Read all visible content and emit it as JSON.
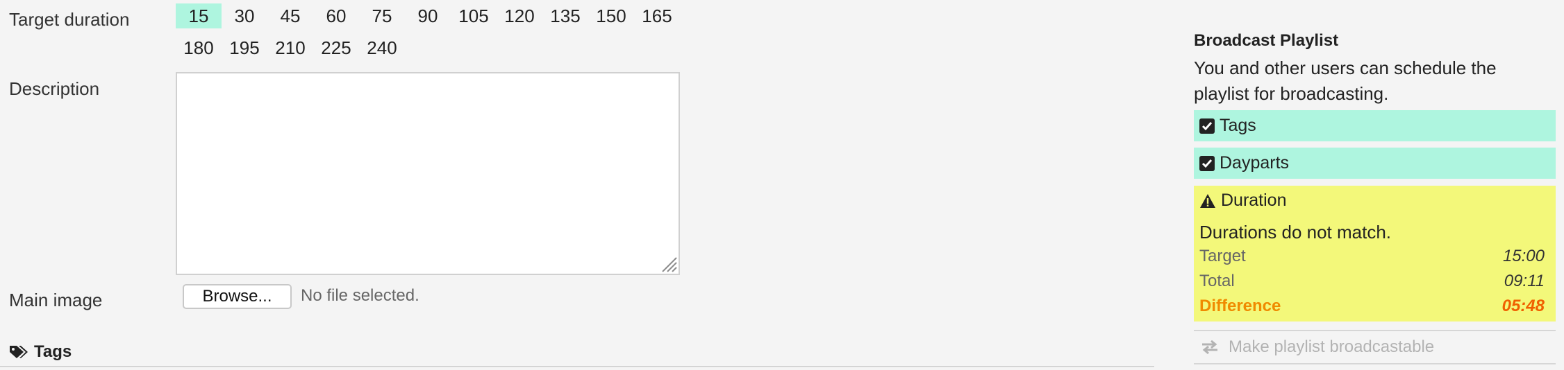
{
  "form": {
    "target_duration_label": "Target duration",
    "duration_options_row1": [
      "15",
      "30",
      "45",
      "60",
      "75",
      "90",
      "105",
      "120",
      "135",
      "150",
      "165"
    ],
    "duration_options_row2": [
      "180",
      "195",
      "210",
      "225",
      "240"
    ],
    "selected_duration": "15",
    "description_label": "Description",
    "description_value": "",
    "main_image_label": "Main image",
    "browse_label": "Browse...",
    "file_status": "No file selected.",
    "tags_section_label": "Tags"
  },
  "sidebar": {
    "title": "Broadcast Playlist",
    "text": "You and other users can schedule the playlist for broadcasting.",
    "checks": [
      {
        "label": "Tags",
        "icon": "checkbox-checked-icon"
      },
      {
        "label": "Dayparts",
        "icon": "checkbox-checked-icon"
      }
    ],
    "duration": {
      "heading": "Duration",
      "icon": "warning-icon",
      "message": "Durations do not match.",
      "target_label": "Target",
      "target_value": "15:00",
      "total_label": "Total",
      "total_value": "09:11",
      "difference_label": "Difference",
      "difference_value": "05:48"
    },
    "make_broadcastable_label": "Make playlist broadcastable"
  },
  "colors": {
    "selected_bg": "#aef5df",
    "success_bg": "#aef5df",
    "warning_bg": "#f3f87a",
    "difference_text": "#f06000",
    "page_bg": "#f4f4f4"
  }
}
